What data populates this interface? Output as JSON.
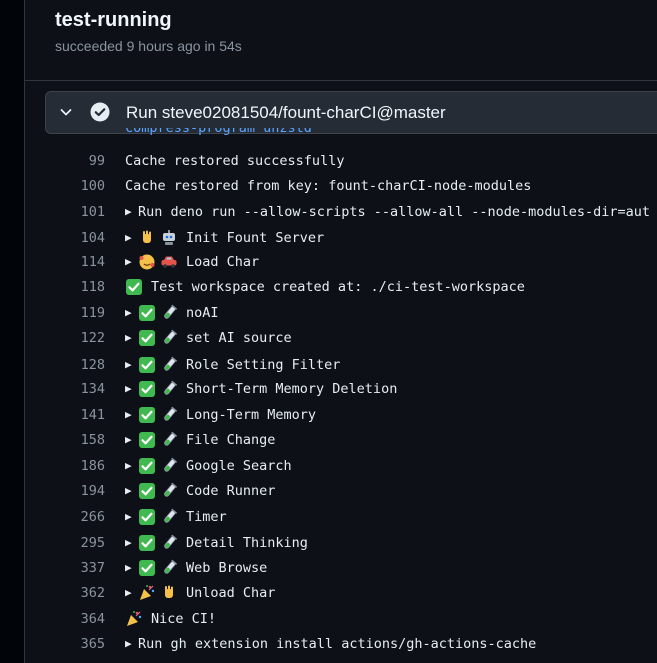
{
  "job": {
    "title": "test-running",
    "status": "succeeded 9 hours ago in 54s"
  },
  "step": {
    "title": "Run steve02081504/fount-charCI@master"
  },
  "log": {
    "partial_line": "compress-program unzstd",
    "lines": [
      {
        "n": "99",
        "text": "Cache restored successfully"
      },
      {
        "n": "100",
        "text": "Cache restored from key: fount-charCI-node-modules"
      },
      {
        "n": "101",
        "text": "Run deno run --allow-scripts --allow-all --node-modules-dir=aut"
      },
      {
        "n": "104",
        "text": "Init Fount Server"
      },
      {
        "n": "114",
        "text": "Load Char"
      },
      {
        "n": "118",
        "text": "Test workspace created at: ./ci-test-workspace"
      },
      {
        "n": "119",
        "text": "noAI"
      },
      {
        "n": "122",
        "text": "set AI source"
      },
      {
        "n": "128",
        "text": "Role Setting Filter"
      },
      {
        "n": "134",
        "text": "Short-Term Memory Deletion"
      },
      {
        "n": "141",
        "text": "Long-Term Memory"
      },
      {
        "n": "158",
        "text": "File Change"
      },
      {
        "n": "186",
        "text": "Google Search"
      },
      {
        "n": "194",
        "text": "Code Runner"
      },
      {
        "n": "266",
        "text": "Timer"
      },
      {
        "n": "295",
        "text": "Detail Thinking"
      },
      {
        "n": "337",
        "text": "Web Browse"
      },
      {
        "n": "362",
        "text": "Unload Char"
      },
      {
        "n": "364",
        "text": "Nice CI!"
      },
      {
        "n": "365",
        "text": "Run gh extension install actions/gh-actions-cache"
      }
    ]
  },
  "colors": {
    "success": "#3fb950",
    "accent": "#58a6ff"
  }
}
